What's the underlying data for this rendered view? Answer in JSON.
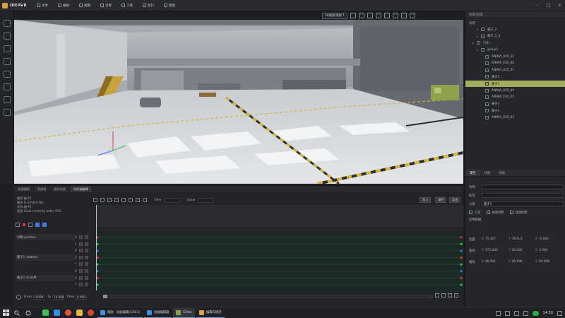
{
  "app": {
    "logo_text": "IDEAVR",
    "menu": [
      "文件",
      "编辑",
      "视图",
      "仓库",
      "工具",
      "窗口",
      "帮助"
    ]
  },
  "viewport_toolbar": {
    "camera_dropdown": "3D视图/透视 1"
  },
  "scene_panel": {
    "header": "场景/层级",
    "subheader": "场景",
    "tree": [
      {
        "label": "箱子_2",
        "depth": 2
      },
      {
        "label": "箱子_2_2",
        "depth": 2
      },
      {
        "label": "汽车",
        "depth": 1
      },
      {
        "label": "group1",
        "depth": 2
      },
      {
        "label": "ANIMA_035_01",
        "depth": 3
      },
      {
        "label": "ANIMA_035_06",
        "depth": 3
      },
      {
        "label": "ANIMA_035_07",
        "depth": 3
      },
      {
        "label": "箱子1",
        "depth": 3
      },
      {
        "label": "箱子1",
        "depth": 3,
        "selected": true
      },
      {
        "label": "ANIMA_035_04",
        "depth": 3
      },
      {
        "label": "ANIMA_035_05",
        "depth": 3
      },
      {
        "label": "箱子1",
        "depth": 3
      },
      {
        "label": "箱子1",
        "depth": 3
      },
      {
        "label": "ANIMA_035_03",
        "depth": 3
      }
    ]
  },
  "properties": {
    "tabs": [
      "属性",
      "材质",
      "动画"
    ],
    "rows": [
      {
        "label": "名称",
        "value": ""
      },
      {
        "label": "标签",
        "value": ""
      },
      {
        "label": "父级",
        "value": "箱子1"
      }
    ],
    "checks": [
      "可见",
      "投射阴影",
      "接收阴影"
    ],
    "check_extra": "启用碰撞",
    "transform": [
      {
        "label": "位置",
        "x": "75.027",
        "y": "3191.4",
        "z": "-5.463"
      },
      {
        "label": "旋转",
        "x": "275.000",
        "y": "90.000",
        "z": "0.000"
      },
      {
        "label": "缩放",
        "x": "99.991",
        "y": "99.998",
        "z": "99.998"
      }
    ]
  },
  "timeline": {
    "tabs": [
      "动画编辑",
      "关键帧",
      "路径动画",
      "时间轴编辑"
    ],
    "info_lines": [
      "模型 箱子1",
      "路径 fx.8:fx8.0 fbx",
      "名称 箱子1",
      "类型 Smart velocity order XYZ"
    ],
    "toolbar_labels": [
      "Time",
      "Value"
    ],
    "right_buttons": [
      "导入",
      "清空",
      "导出"
    ],
    "tracks": [
      {
        "label": "对象 position",
        "axis": "X",
        "group": true
      },
      {
        "label": "",
        "axis": "Y",
        "group": false
      },
      {
        "label": "",
        "axis": "Z",
        "group": false
      },
      {
        "label": "箱子1 rotation",
        "axis": "X",
        "group": true
      },
      {
        "label": "",
        "axis": "Y",
        "group": false
      },
      {
        "label": "",
        "axis": "Z",
        "group": false
      },
      {
        "label": "箱子1 scaleM",
        "axis": "X",
        "group": true
      },
      {
        "label": "",
        "axis": "Y",
        "group": false
      }
    ],
    "from_label": "From",
    "from_value": "0.000",
    "to_label": "To",
    "to_value": "10.000",
    "time_label": "Time",
    "time_value": "0.000"
  },
  "taskbar": {
    "tasks": [
      {
        "label": "播放 - 动画编辑(1/303)",
        "color": "#3c8fe6",
        "active": false
      },
      {
        "label": "动画编辑器",
        "color": "#3c8fe6",
        "active": false
      },
      {
        "label": "Editor",
        "color": "#8aa24a",
        "active": true
      },
      {
        "label": "编辑车模型",
        "color": "#e2a13a",
        "active": false
      }
    ],
    "clock": "14:50"
  }
}
